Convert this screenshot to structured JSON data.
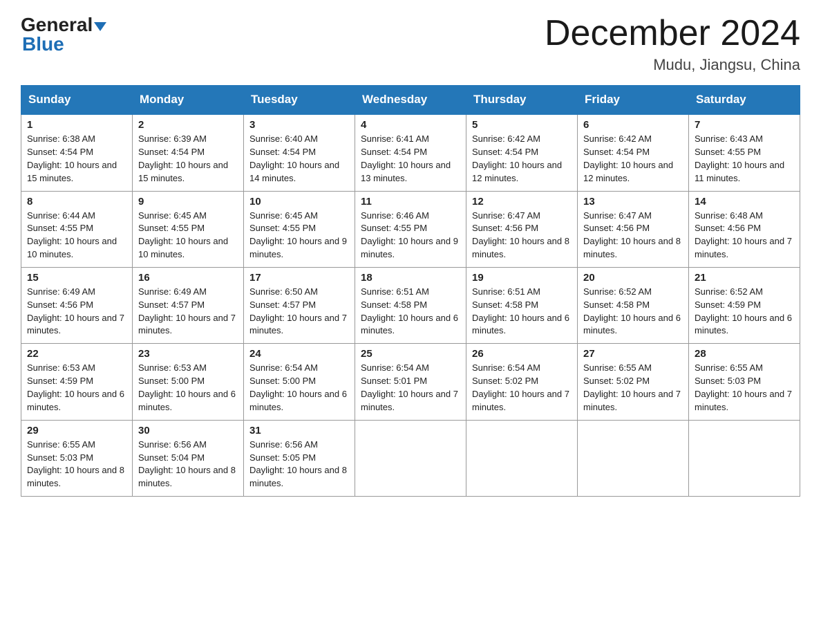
{
  "logo": {
    "word1": "General",
    "word2": "Blue"
  },
  "header": {
    "month": "December 2024",
    "location": "Mudu, Jiangsu, China"
  },
  "days_of_week": [
    "Sunday",
    "Monday",
    "Tuesday",
    "Wednesday",
    "Thursday",
    "Friday",
    "Saturday"
  ],
  "weeks": [
    [
      {
        "day": "1",
        "sunrise": "Sunrise: 6:38 AM",
        "sunset": "Sunset: 4:54 PM",
        "daylight": "Daylight: 10 hours and 15 minutes."
      },
      {
        "day": "2",
        "sunrise": "Sunrise: 6:39 AM",
        "sunset": "Sunset: 4:54 PM",
        "daylight": "Daylight: 10 hours and 15 minutes."
      },
      {
        "day": "3",
        "sunrise": "Sunrise: 6:40 AM",
        "sunset": "Sunset: 4:54 PM",
        "daylight": "Daylight: 10 hours and 14 minutes."
      },
      {
        "day": "4",
        "sunrise": "Sunrise: 6:41 AM",
        "sunset": "Sunset: 4:54 PM",
        "daylight": "Daylight: 10 hours and 13 minutes."
      },
      {
        "day": "5",
        "sunrise": "Sunrise: 6:42 AM",
        "sunset": "Sunset: 4:54 PM",
        "daylight": "Daylight: 10 hours and 12 minutes."
      },
      {
        "day": "6",
        "sunrise": "Sunrise: 6:42 AM",
        "sunset": "Sunset: 4:54 PM",
        "daylight": "Daylight: 10 hours and 12 minutes."
      },
      {
        "day": "7",
        "sunrise": "Sunrise: 6:43 AM",
        "sunset": "Sunset: 4:55 PM",
        "daylight": "Daylight: 10 hours and 11 minutes."
      }
    ],
    [
      {
        "day": "8",
        "sunrise": "Sunrise: 6:44 AM",
        "sunset": "Sunset: 4:55 PM",
        "daylight": "Daylight: 10 hours and 10 minutes."
      },
      {
        "day": "9",
        "sunrise": "Sunrise: 6:45 AM",
        "sunset": "Sunset: 4:55 PM",
        "daylight": "Daylight: 10 hours and 10 minutes."
      },
      {
        "day": "10",
        "sunrise": "Sunrise: 6:45 AM",
        "sunset": "Sunset: 4:55 PM",
        "daylight": "Daylight: 10 hours and 9 minutes."
      },
      {
        "day": "11",
        "sunrise": "Sunrise: 6:46 AM",
        "sunset": "Sunset: 4:55 PM",
        "daylight": "Daylight: 10 hours and 9 minutes."
      },
      {
        "day": "12",
        "sunrise": "Sunrise: 6:47 AM",
        "sunset": "Sunset: 4:56 PM",
        "daylight": "Daylight: 10 hours and 8 minutes."
      },
      {
        "day": "13",
        "sunrise": "Sunrise: 6:47 AM",
        "sunset": "Sunset: 4:56 PM",
        "daylight": "Daylight: 10 hours and 8 minutes."
      },
      {
        "day": "14",
        "sunrise": "Sunrise: 6:48 AM",
        "sunset": "Sunset: 4:56 PM",
        "daylight": "Daylight: 10 hours and 7 minutes."
      }
    ],
    [
      {
        "day": "15",
        "sunrise": "Sunrise: 6:49 AM",
        "sunset": "Sunset: 4:56 PM",
        "daylight": "Daylight: 10 hours and 7 minutes."
      },
      {
        "day": "16",
        "sunrise": "Sunrise: 6:49 AM",
        "sunset": "Sunset: 4:57 PM",
        "daylight": "Daylight: 10 hours and 7 minutes."
      },
      {
        "day": "17",
        "sunrise": "Sunrise: 6:50 AM",
        "sunset": "Sunset: 4:57 PM",
        "daylight": "Daylight: 10 hours and 7 minutes."
      },
      {
        "day": "18",
        "sunrise": "Sunrise: 6:51 AM",
        "sunset": "Sunset: 4:58 PM",
        "daylight": "Daylight: 10 hours and 6 minutes."
      },
      {
        "day": "19",
        "sunrise": "Sunrise: 6:51 AM",
        "sunset": "Sunset: 4:58 PM",
        "daylight": "Daylight: 10 hours and 6 minutes."
      },
      {
        "day": "20",
        "sunrise": "Sunrise: 6:52 AM",
        "sunset": "Sunset: 4:58 PM",
        "daylight": "Daylight: 10 hours and 6 minutes."
      },
      {
        "day": "21",
        "sunrise": "Sunrise: 6:52 AM",
        "sunset": "Sunset: 4:59 PM",
        "daylight": "Daylight: 10 hours and 6 minutes."
      }
    ],
    [
      {
        "day": "22",
        "sunrise": "Sunrise: 6:53 AM",
        "sunset": "Sunset: 4:59 PM",
        "daylight": "Daylight: 10 hours and 6 minutes."
      },
      {
        "day": "23",
        "sunrise": "Sunrise: 6:53 AM",
        "sunset": "Sunset: 5:00 PM",
        "daylight": "Daylight: 10 hours and 6 minutes."
      },
      {
        "day": "24",
        "sunrise": "Sunrise: 6:54 AM",
        "sunset": "Sunset: 5:00 PM",
        "daylight": "Daylight: 10 hours and 6 minutes."
      },
      {
        "day": "25",
        "sunrise": "Sunrise: 6:54 AM",
        "sunset": "Sunset: 5:01 PM",
        "daylight": "Daylight: 10 hours and 7 minutes."
      },
      {
        "day": "26",
        "sunrise": "Sunrise: 6:54 AM",
        "sunset": "Sunset: 5:02 PM",
        "daylight": "Daylight: 10 hours and 7 minutes."
      },
      {
        "day": "27",
        "sunrise": "Sunrise: 6:55 AM",
        "sunset": "Sunset: 5:02 PM",
        "daylight": "Daylight: 10 hours and 7 minutes."
      },
      {
        "day": "28",
        "sunrise": "Sunrise: 6:55 AM",
        "sunset": "Sunset: 5:03 PM",
        "daylight": "Daylight: 10 hours and 7 minutes."
      }
    ],
    [
      {
        "day": "29",
        "sunrise": "Sunrise: 6:55 AM",
        "sunset": "Sunset: 5:03 PM",
        "daylight": "Daylight: 10 hours and 8 minutes."
      },
      {
        "day": "30",
        "sunrise": "Sunrise: 6:56 AM",
        "sunset": "Sunset: 5:04 PM",
        "daylight": "Daylight: 10 hours and 8 minutes."
      },
      {
        "day": "31",
        "sunrise": "Sunrise: 6:56 AM",
        "sunset": "Sunset: 5:05 PM",
        "daylight": "Daylight: 10 hours and 8 minutes."
      },
      null,
      null,
      null,
      null
    ]
  ]
}
